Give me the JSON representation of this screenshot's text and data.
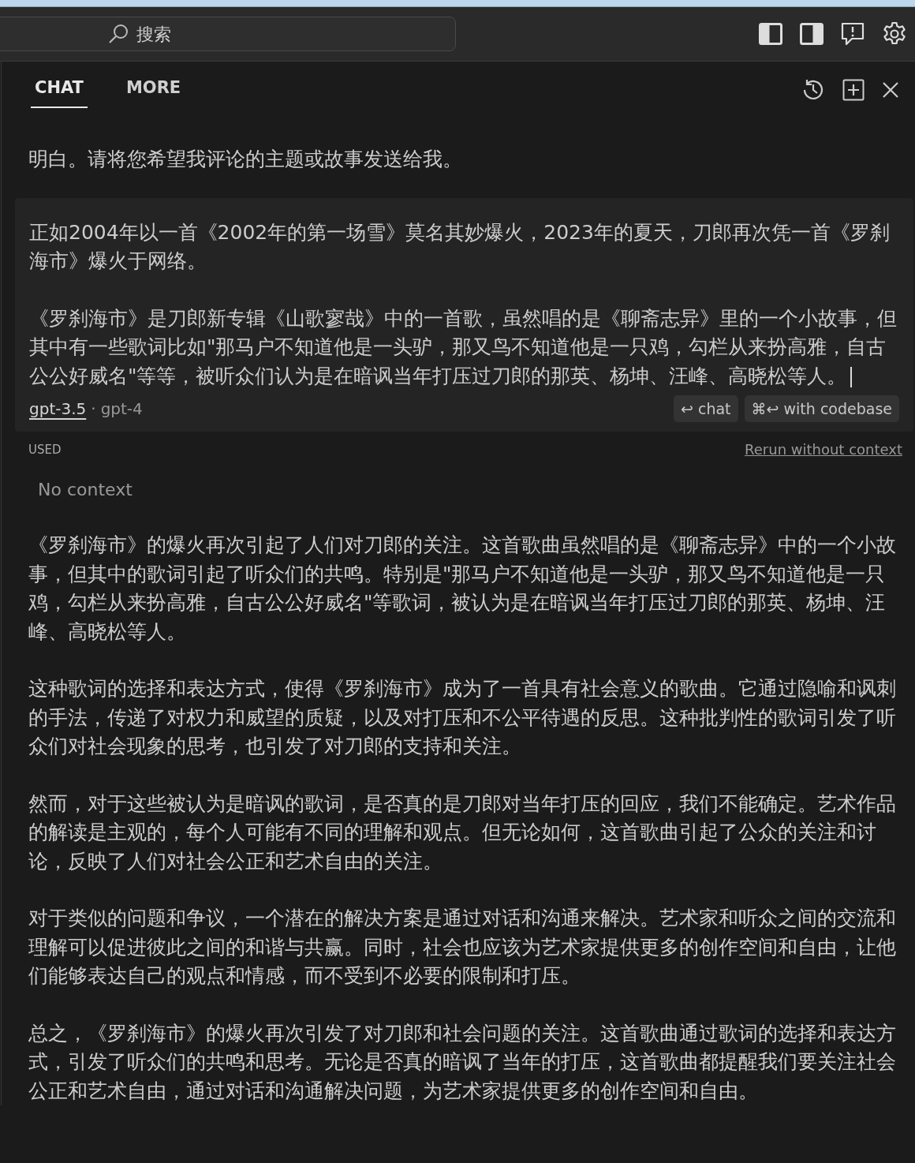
{
  "topbar": {
    "search": {
      "placeholder": "搜索"
    }
  },
  "tabs": [
    {
      "label": "CHAT",
      "selected": true
    },
    {
      "label": "MORE",
      "selected": false
    }
  ],
  "intro_message": {
    "paragraphs": [
      "明白。请将您希望我评论的主题或故事发送给我。"
    ]
  },
  "composer": {
    "paragraphs": [
      "正如2004年以一首《2002年的第一场雪》莫名其妙爆火，2023年的夏天，刀郎再次凭一首《罗刹海市》爆火于网络。",
      "《罗刹海市》是刀郎新专辑《山歌寥哉》中的一首歌，虽然唱的是《聊斋志异》里的一个小故事，但其中有一些歌词比如\"那马户不知道他是一头驴，那又鸟不知道他是一只鸡，勾栏从来扮高雅，自古公公好威名\"等等，被听众们认为是在暗讽当年打压过刀郎的那英、杨坤、汪峰、高晓松等人。"
    ],
    "caret": true,
    "models": [
      {
        "label": "gpt-3.5",
        "selected": true
      },
      {
        "label": "gpt-4",
        "selected": false
      }
    ],
    "model_separator": "·",
    "actions": [
      {
        "keys": "↩",
        "label": "chat"
      },
      {
        "keys": "⌘↩",
        "label": "with codebase"
      }
    ]
  },
  "context": {
    "heading": "USED",
    "rerun_link": "Rerun without context",
    "items_text": "No context"
  },
  "response": {
    "paragraphs": [
      "《罗刹海市》的爆火再次引起了人们对刀郎的关注。这首歌曲虽然唱的是《聊斋志异》中的一个小故事，但其中的歌词引起了听众们的共鸣。特别是\"那马户不知道他是一头驴，那又鸟不知道他是一只鸡，勾栏从来扮高雅，自古公公好威名\"等歌词，被认为是在暗讽当年打压过刀郎的那英、杨坤、汪峰、高晓松等人。",
      "这种歌词的选择和表达方式，使得《罗刹海市》成为了一首具有社会意义的歌曲。它通过隐喻和讽刺的手法，传递了对权力和威望的质疑，以及对打压和不公平待遇的反思。这种批判性的歌词引发了听众们对社会现象的思考，也引发了对刀郎的支持和关注。",
      "然而，对于这些被认为是暗讽的歌词，是否真的是刀郎对当年打压的回应，我们不能确定。艺术作品的解读是主观的，每个人可能有不同的理解和观点。但无论如何，这首歌曲引起了公众的关注和讨论，反映了人们对社会公正和艺术自由的关注。",
      "对于类似的问题和争议，一个潜在的解决方案是通过对话和沟通来解决。艺术家和听众之间的交流和理解可以促进彼此之间的和谐与共赢。同时，社会也应该为艺术家提供更多的创作空间和自由，让他们能够表达自己的观点和情感，而不受到不必要的限制和打压。",
      "总之，《罗刹海市》的爆火再次引发了对刀郎和社会问题的关注。这首歌曲通过歌词的选择和表达方式，引发了听众们的共鸣和思考。无论是否真的暗讽了当年的打压，这首歌曲都提醒我们要关注社会公正和艺术自由，通过对话和沟通解决问题，为艺术家提供更多的创作空间和自由。"
    ]
  }
}
